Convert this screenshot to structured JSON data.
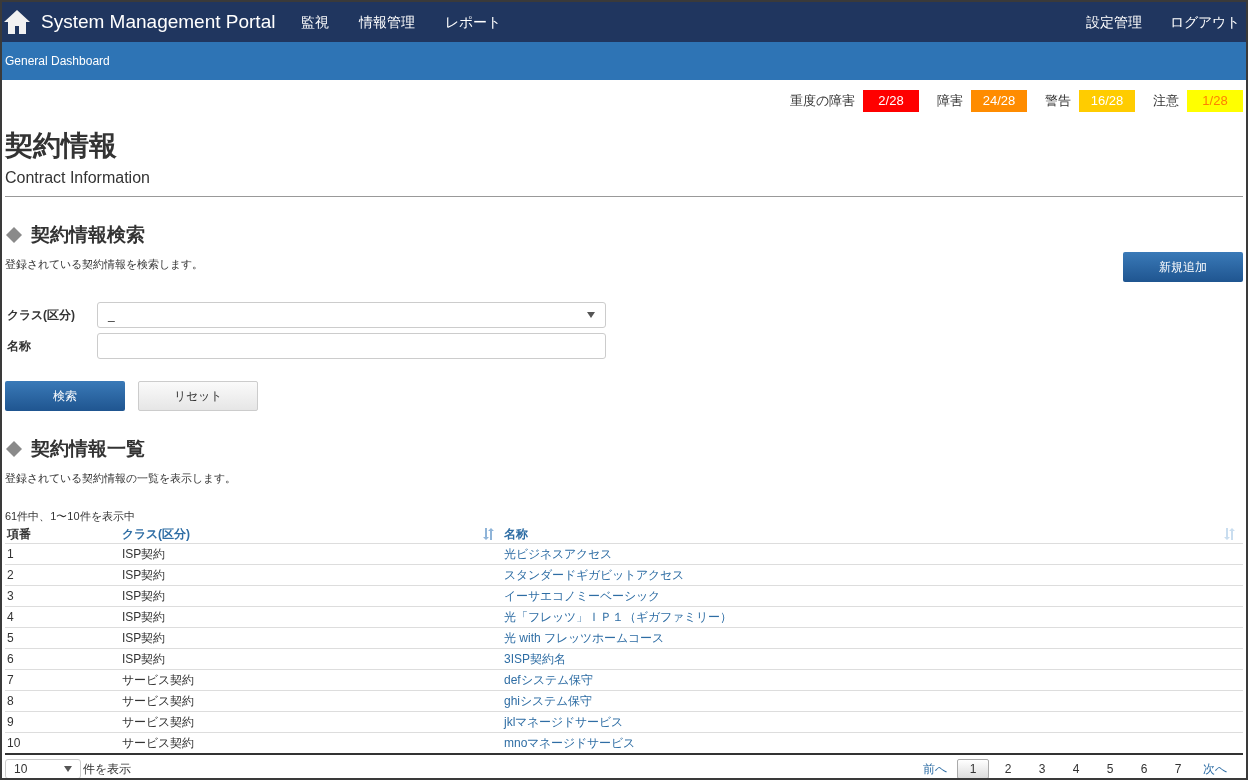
{
  "navbar": {
    "title": "System Management Portal",
    "menu": [
      "監視",
      "情報管理",
      "レポート"
    ],
    "right_menu": [
      "設定管理",
      "ログアウト"
    ]
  },
  "breadcrumb": "General Dashboard",
  "alerts": [
    {
      "label": "重度の障害",
      "count": "2/28",
      "color": "#ff0000"
    },
    {
      "label": "障害",
      "count": "24/28",
      "color": "#ff8c00"
    },
    {
      "label": "警告",
      "count": "16/28",
      "color": "#ffcc00"
    },
    {
      "label": "注意",
      "count": "1/28",
      "color": "#ffff00"
    }
  ],
  "page": {
    "title": "契約情報",
    "subtitle": "Contract Information"
  },
  "search_section": {
    "heading": "契約情報検索",
    "description": "登録されている契約情報を検索します。",
    "add_button": "新規追加",
    "fields": [
      {
        "kind": "select",
        "label": "クラス(区分)",
        "value": "_"
      },
      {
        "kind": "text",
        "label": "名称"
      }
    ],
    "search_button": "検索",
    "reset_button": "リセット"
  },
  "list_section": {
    "heading": "契約情報一覧",
    "description": "登録されている契約情報の一覧を表示します。",
    "count_text": "61件中、1〜10件を表示中",
    "table": {
      "columns": [
        {
          "label": "項番",
          "link": false,
          "sort_icon": false
        },
        {
          "label": "クラス(区分)",
          "link": true,
          "sort_icon": true
        },
        {
          "label": "名称",
          "link": true,
          "sort_icon": true
        }
      ],
      "rows": [
        [
          "1",
          "ISP契約",
          "光ビジネスアクセス"
        ],
        [
          "2",
          "ISP契約",
          "スタンダードギガビットアクセス"
        ],
        [
          "3",
          "ISP契約",
          "イーサエコノミーベーシック"
        ],
        [
          "4",
          "ISP契約",
          "光「フレッツ」ＩＰ１（ギガファミリー）"
        ],
        [
          "5",
          "ISP契約",
          "光 with フレッツホームコース"
        ],
        [
          "6",
          "ISP契約",
          "3ISP契約名"
        ],
        [
          "7",
          "サービス契約",
          "defシステム保守"
        ],
        [
          "8",
          "サービス契約",
          "ghiシステム保守"
        ],
        [
          "9",
          "サービス契約",
          "jklマネージドサービス"
        ],
        [
          "10",
          "サービス契約",
          "mnoマネージドサービス"
        ]
      ]
    },
    "page_size": {
      "value": "10",
      "label": "件を表示"
    },
    "pagination": {
      "prev": "前へ",
      "next": "次へ",
      "pages": [
        {
          "label": "1",
          "selected": true
        },
        {
          "label": "2",
          "selected": false
        },
        {
          "label": "3",
          "selected": false
        },
        {
          "label": "4",
          "selected": false
        },
        {
          "label": "5",
          "selected": false
        },
        {
          "label": "6",
          "selected": false
        },
        {
          "label": "7",
          "selected": false
        }
      ]
    }
  }
}
